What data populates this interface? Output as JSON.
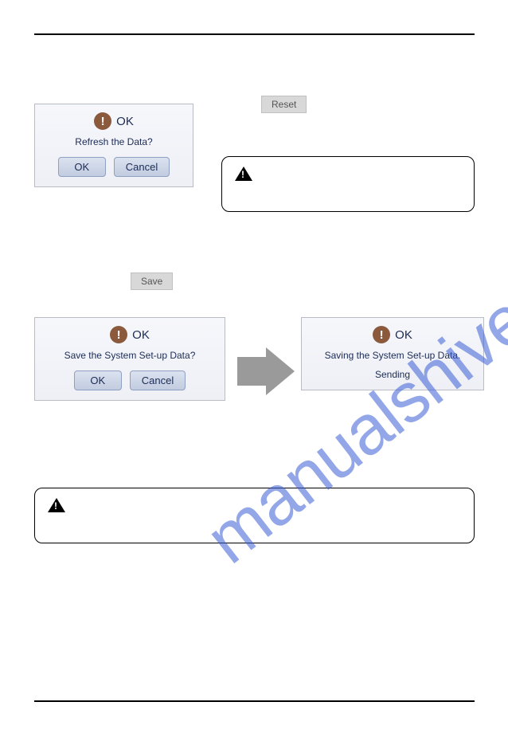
{
  "watermark": "manualshive.com",
  "buttons": {
    "reset": "Reset",
    "save": "Save",
    "ok": "OK",
    "cancel": "Cancel"
  },
  "dialog1": {
    "title": "OK",
    "message": "Refresh the Data?"
  },
  "dialog2": {
    "title": "OK",
    "message": "Save the System Set-up Data?"
  },
  "dialog3": {
    "title": "OK",
    "message": "Saving the System Set-up Data.",
    "status": "Sending"
  }
}
